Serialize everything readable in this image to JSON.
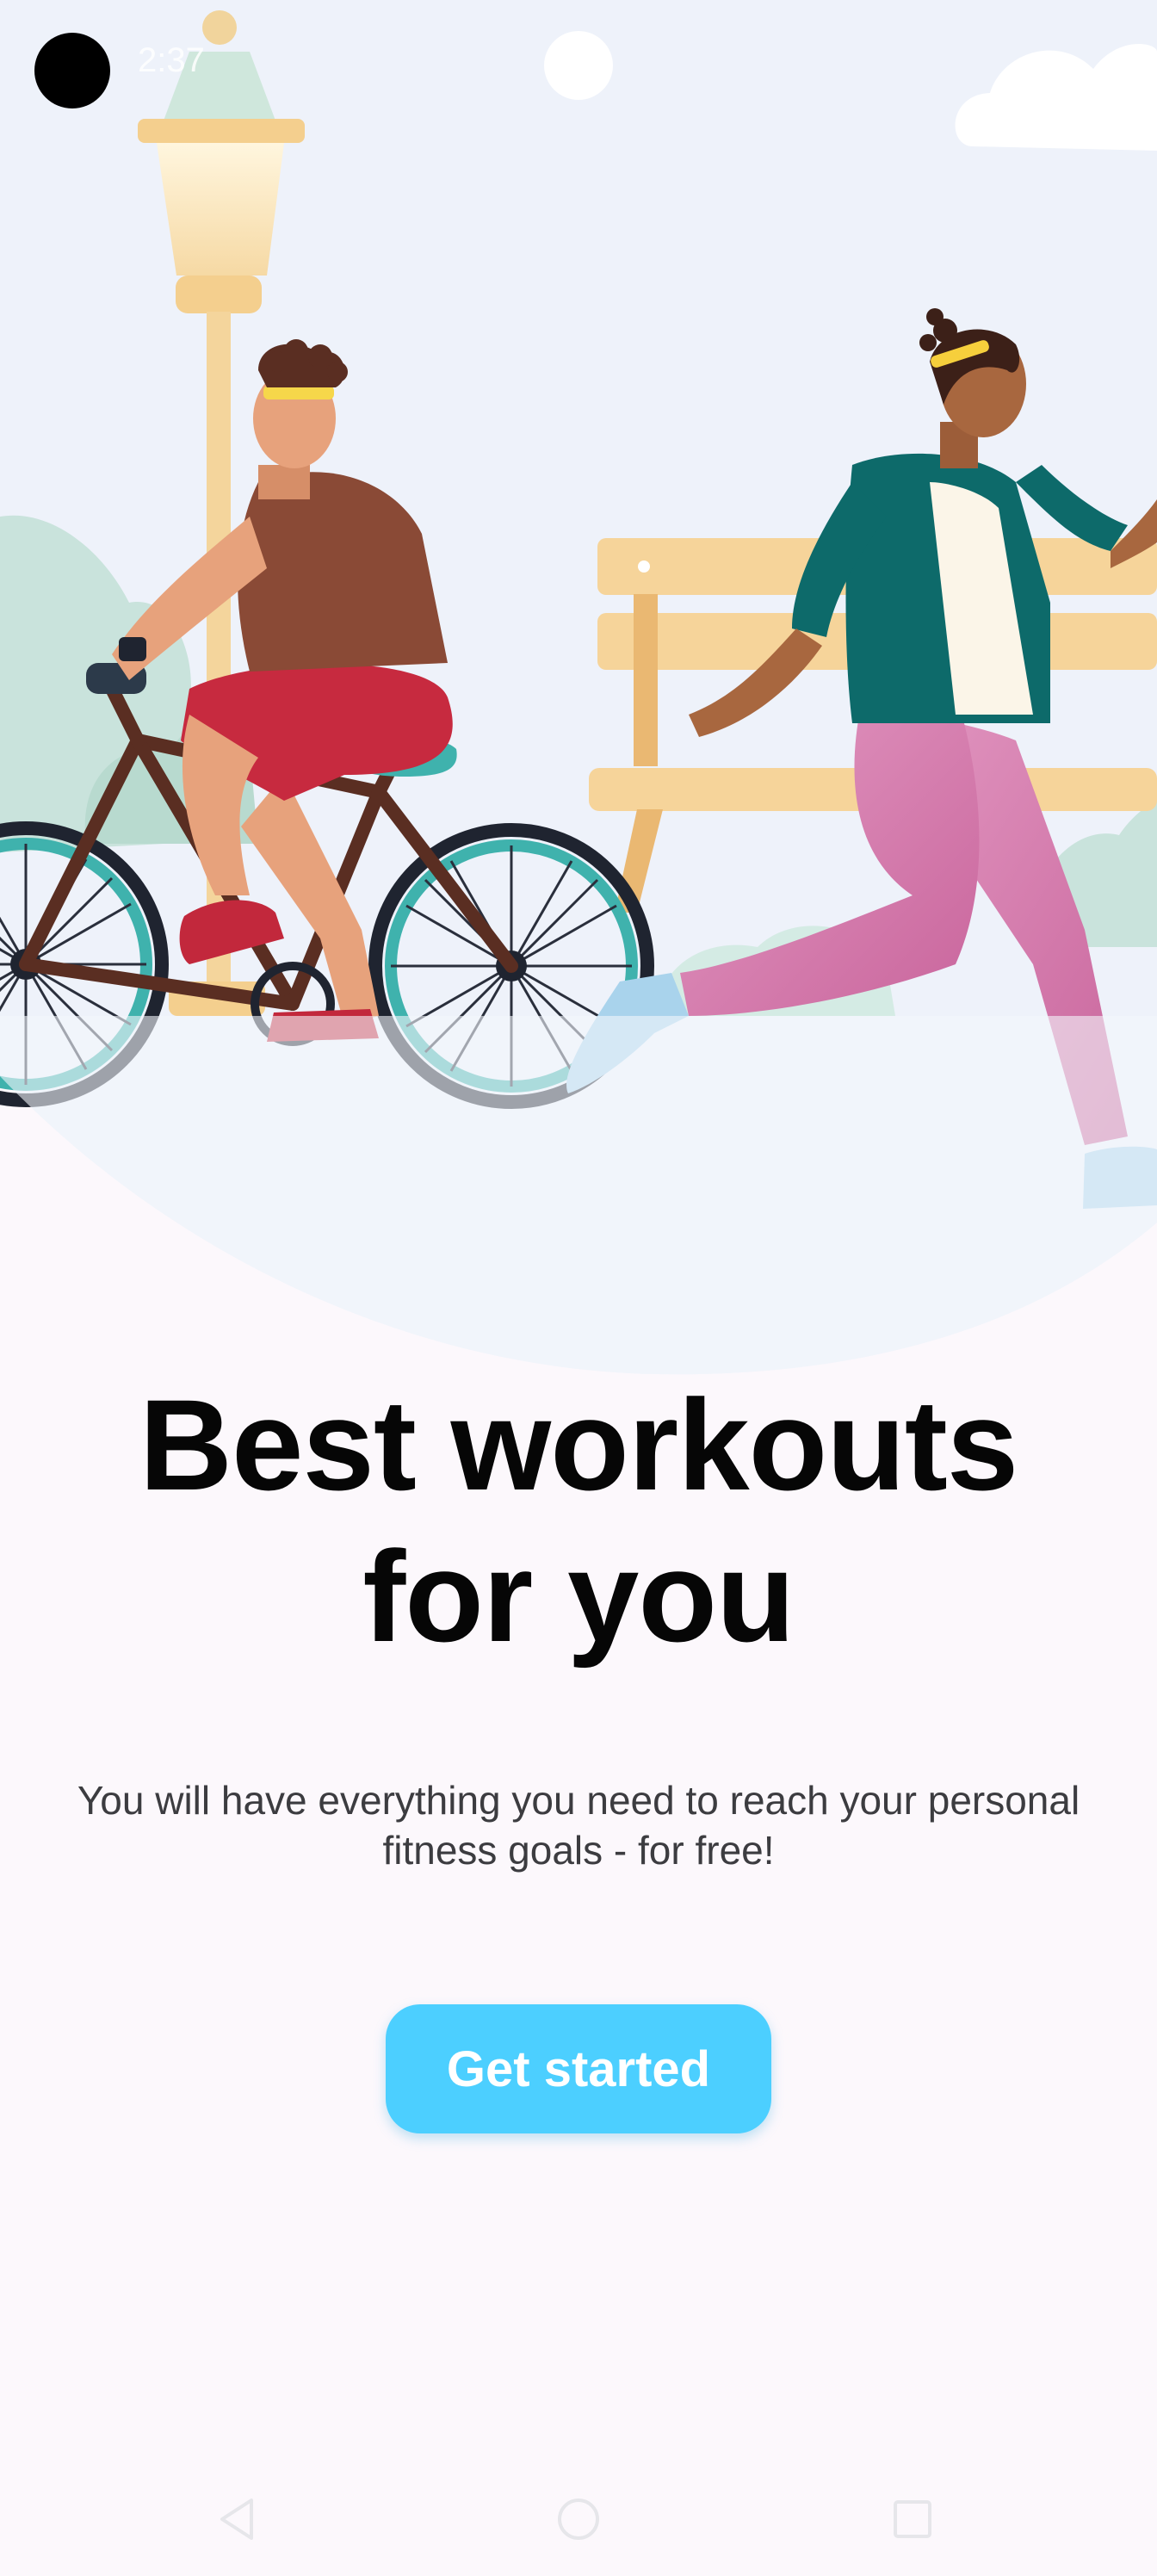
{
  "status_bar": {
    "time": "2:37"
  },
  "onboarding": {
    "headline_line1": "Best workouts",
    "headline_line2": "for you",
    "subtitle_line1": "You will have everything you need to reach your personal",
    "subtitle_line2": "fitness goals - for free!",
    "cta_label": "Get started"
  },
  "illustration": {
    "icons": [
      "street-lamp-icon",
      "park-bench-icon",
      "cyclist-icon",
      "bicycle-icon",
      "runner-icon",
      "cloud-icon",
      "bush-icon"
    ]
  },
  "navigation_bar": {
    "icons": [
      "back-triangle-icon",
      "home-circle-icon",
      "recents-square-icon"
    ]
  },
  "colors": {
    "accent": "#4ccfff",
    "background": "#fcf8fc",
    "hero_background": "#eef2fa",
    "headline": "#060606",
    "subtitle": "#3c3c40"
  }
}
